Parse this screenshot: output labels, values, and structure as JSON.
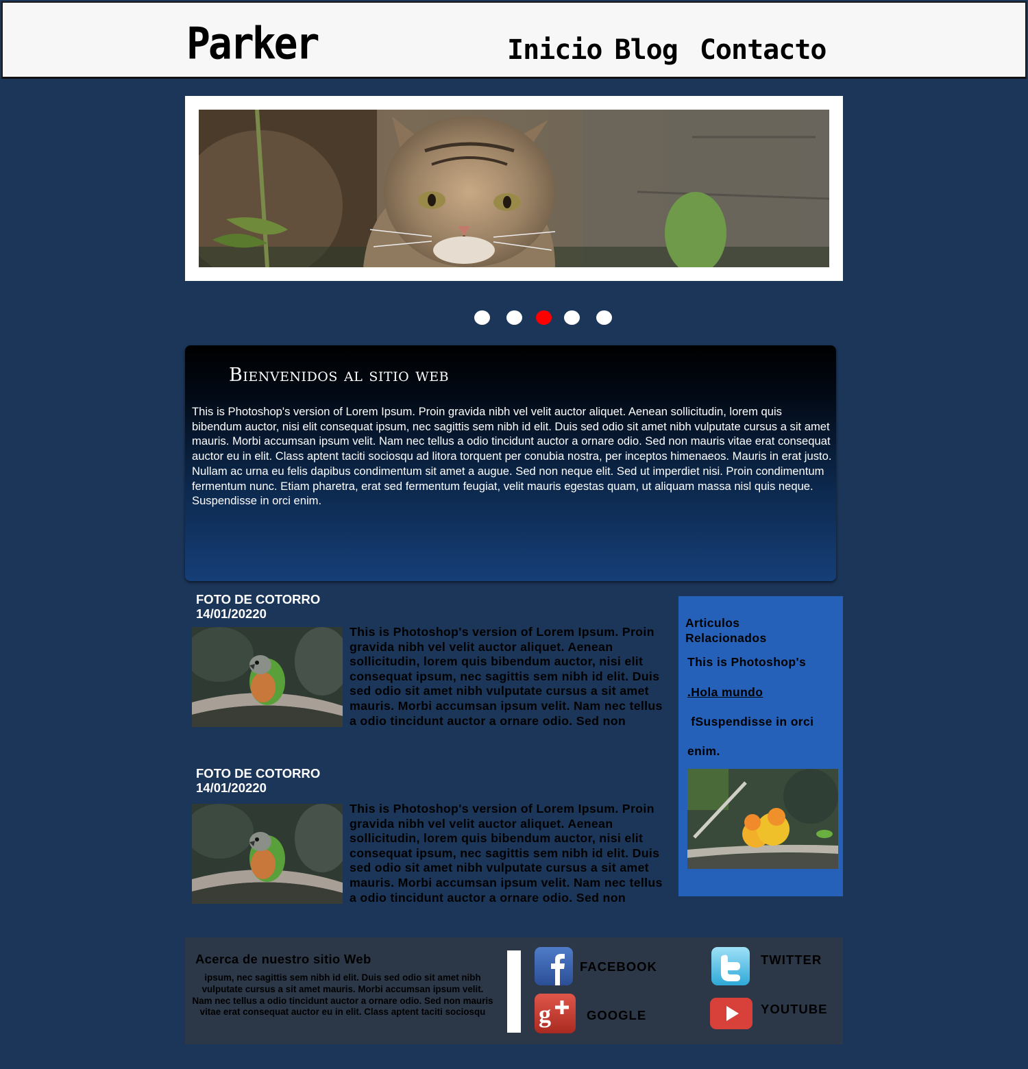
{
  "header": {
    "brand": "Parker",
    "nav": [
      "Inicio",
      "Blog",
      "Contacto"
    ]
  },
  "hero": {
    "image": "cat-photo"
  },
  "carousel": {
    "count": 5,
    "active_index": 2,
    "active_color": "#ff0000",
    "dot_color": "#ffffff"
  },
  "welcome": {
    "title": "Bienvenidos al sitio web",
    "body": "This is Photoshop's version  of Lorem Ipsum. Proin gravida nibh vel velit auctor aliquet. Aenean sollicitudin, lorem quis bibendum auctor, nisi elit consequat ipsum, nec sagittis sem nibh id elit. Duis sed odio sit amet nibh vulputate cursus a sit amet mauris. Morbi accumsan ipsum velit. Nam nec tellus a odio tincidunt auctor a ornare odio. Sed non  mauris vitae erat consequat auctor eu in elit. Class aptent taciti sociosqu ad litora torquent per conubia nostra, per inceptos himenaeos. Mauris in erat justo. Nullam ac urna eu felis dapibus condimentum sit amet a augue. Sed non neque elit. Sed ut imperdiet nisi. Proin condimentum fermentum nunc. Etiam pharetra, erat sed fermentum feugiat, velit mauris egestas quam, ut aliquam massa nisl quis neque. Suspendisse in orci enim."
  },
  "posts": [
    {
      "title": "FOTO DE COTORRO",
      "date": "14/01/20220",
      "text": "This is Photoshop's version  of Lorem Ipsum. Proin gravida nibh vel velit auctor aliquet. Aenean sollicitudin, lorem quis bibendum auctor, nisi elit consequat ipsum, nec sagittis sem nibh id elit. Duis sed odio sit amet nibh vulputate cursus a sit amet mauris. Morbi accumsan ipsum velit. Nam nec tellus a odio tincidunt auctor a ornare odio. Sed non"
    },
    {
      "title": "FOTO DE COTORRO",
      "date": "14/01/20220",
      "text": "This is Photoshop's version  of Lorem Ipsum. Proin gravida nibh vel velit auctor aliquet. Aenean sollicitudin, lorem quis bibendum auctor, nisi elit consequat ipsum, nec sagittis sem nibh id elit. Duis sed odio sit amet nibh vulputate cursus a sit amet mauris. Morbi accumsan ipsum velit. Nam nec tellus a odio tincidunt auctor a ornare odio. Sed non"
    }
  ],
  "sidebar": {
    "heading_line1": "Articulos",
    "heading_line2": "Relacionados",
    "items": [
      "This is Photoshop's",
      ".Hola mundo",
      " fSuspendisse in orci",
      "enim."
    ]
  },
  "footer": {
    "about_title": "Acerca de nuestro sitio Web",
    "about_text": "ipsum, nec sagittis sem nibh id elit. Duis sed odio sit amet nibh vulputate cursus a sit amet mauris. Morbi accumsan ipsum velit. Nam nec tellus a odio tincidunt auctor a ornare odio. Sed non  mauris vitae erat consequat auctor eu in elit. Class aptent taciti sociosqu",
    "social": [
      {
        "label": "FACEBOOK",
        "icon": "facebook-icon"
      },
      {
        "label": "TWITTER",
        "icon": "twitter-icon"
      },
      {
        "label": "GOOGLE",
        "icon": "google-plus-icon"
      },
      {
        "label": "YOUTUBE",
        "icon": "youtube-icon"
      }
    ]
  }
}
